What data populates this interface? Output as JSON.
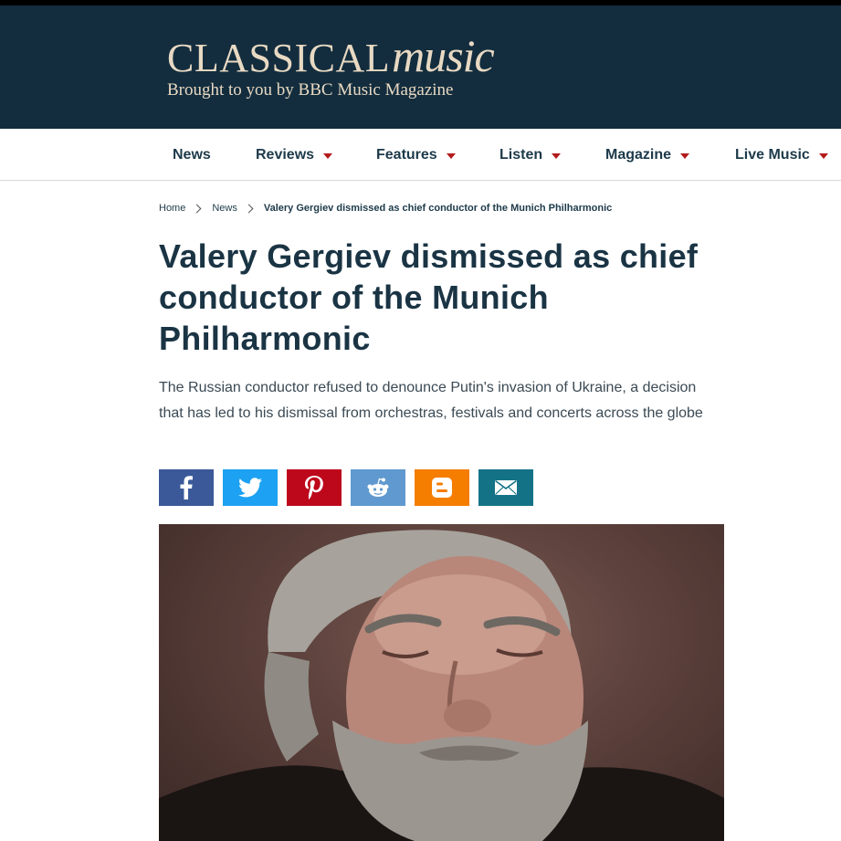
{
  "masthead": {
    "logo_classical": "CLASSICAL",
    "logo_music": "music",
    "tagline": "Brought to you by BBC Music Magazine"
  },
  "nav": {
    "items": [
      {
        "label": "News",
        "has_dropdown": false
      },
      {
        "label": "Reviews",
        "has_dropdown": true
      },
      {
        "label": "Features",
        "has_dropdown": true
      },
      {
        "label": "Listen",
        "has_dropdown": true
      },
      {
        "label": "Magazine",
        "has_dropdown": true
      },
      {
        "label": "Live Music",
        "has_dropdown": true
      }
    ]
  },
  "breadcrumb": {
    "home": "Home",
    "news": "News",
    "current": "Valery Gergiev dismissed as chief conductor of the Munich Philharmonic"
  },
  "article": {
    "headline": "Valery Gergiev dismissed as chief conductor of the Munich Philharmonic",
    "standfirst": "The Russian conductor refused to denounce Putin's invasion of Ukraine, a decision that has led to his dismissal from orchestras, festivals and concerts across the globe"
  },
  "share": {
    "buttons": [
      {
        "icon": "facebook-icon",
        "color": "#3b5998"
      },
      {
        "icon": "twitter-icon",
        "color": "#1da1f2"
      },
      {
        "icon": "pinterest-icon",
        "color": "#bd081c"
      },
      {
        "icon": "reddit-icon",
        "color": "#5f99cf"
      },
      {
        "icon": "blogger-icon",
        "color": "#f57d00"
      },
      {
        "icon": "email-icon",
        "color": "#147287"
      }
    ]
  },
  "colors": {
    "masthead_bg": "#132d3e",
    "logo_text": "#e8d9c3",
    "nav_caret": "#b31b1b",
    "headline": "#1a3444"
  }
}
